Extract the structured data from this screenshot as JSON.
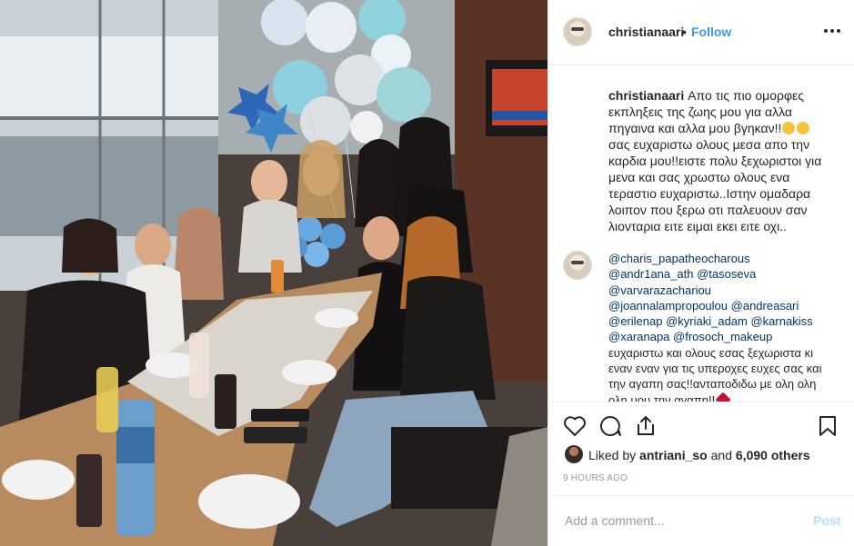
{
  "post": {
    "username": "christianaari",
    "follow_label": "Follow",
    "separator": "•",
    "more_label": "•••"
  },
  "caption": {
    "username": "christianaari",
    "text1": "Απο τις πιο ομορφες εκπληξεις της ζωης μου για αλλα πηγαινα και αλλα μου βγηκαν!!",
    "text2": "σας ευχαριστω ολους μεσα απο την καρδια μου!!ειστε πολυ ξεχωριστοι για μενα και σας χρωστω ολους ενα τεραστιο ευχαριστω..Ιστην ομαδαρα λοιπον που ξερω οτι παλευουν σαν λιονταρια ειτε ειμαι εκει ειτε οχι.."
  },
  "comment": {
    "mentions": [
      "@charis_papatheocharous",
      "@andr1ana_ath",
      "@tasoseva",
      "@varvarazachariou",
      "@joannalampropoulou",
      "@andreasari",
      "@erilenap",
      "@kyriaki_adam",
      "@karnakiss",
      "@xaranapa",
      "@frosoch_makeup"
    ],
    "text": "ευχαριστω και ολους εσας ξεχωριστα κι εναν εναν για τις υπεροχες ευχες σας και την αγαπη σας!!ανταποδιδω με ολη ολη ολη μου την αγαπη!!"
  },
  "likes": {
    "prefix": "Liked by",
    "user": "antriani_so",
    "joiner": "and",
    "count": "6,090 others"
  },
  "timestamp": "9 HOURS AGO",
  "add_comment": {
    "placeholder": "Add a comment...",
    "post_label": "Post"
  },
  "icons": [
    "heart-icon",
    "comment-icon",
    "share-icon",
    "bookmark-icon",
    "more-options-icon"
  ],
  "colors": {
    "link": "#003569",
    "follow": "#3897f0",
    "post_disabled": "#b2dffc",
    "muted": "#999999"
  }
}
